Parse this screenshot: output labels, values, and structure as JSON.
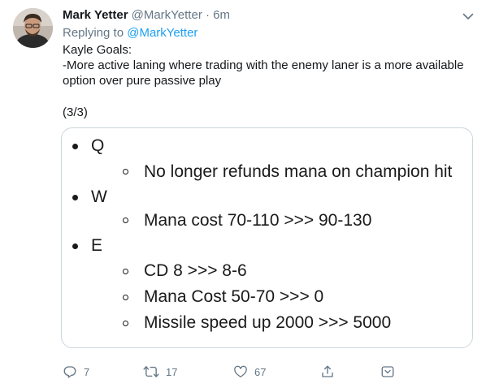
{
  "author": {
    "name": "Mark Yetter",
    "handle": "@MarkYetter",
    "separator": "·",
    "time": "6m"
  },
  "reply": {
    "prefix": "Replying to",
    "to": "@MarkYetter"
  },
  "tweet": {
    "lines": [
      "Kayle Goals:",
      "-More active laning where trading with the enemy laner is a more available option over pure passive play"
    ],
    "counter": "(3/3)"
  },
  "image": {
    "abilities": [
      {
        "label": "Q",
        "changes": [
          "No longer refunds mana on champion hit"
        ]
      },
      {
        "label": "W",
        "changes": [
          "Mana cost 70-110 >>> 90-130"
        ]
      },
      {
        "label": "E",
        "changes": [
          "CD 8 >>> 8-6",
          "Mana Cost 50-70 >>> 0",
          "Missile speed up 2000 >>> 5000"
        ]
      }
    ]
  },
  "actions": {
    "replies": "7",
    "retweets": "17",
    "likes": "67",
    "icons": [
      "reply-icon",
      "retweet-icon",
      "like-icon",
      "share-icon",
      "bookmark-icon"
    ]
  },
  "colors": {
    "link": "#1da1f2",
    "muted": "#657786",
    "text": "#14171a",
    "border": "#ccd6dd"
  }
}
